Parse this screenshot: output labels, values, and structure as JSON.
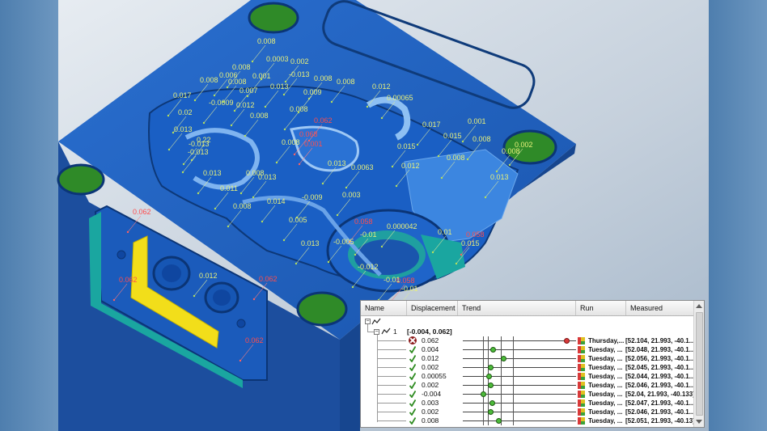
{
  "colors": {
    "background": "#6a90b4",
    "part_blue": "#1e5fb8",
    "pocket_green": "#2f8a28",
    "highlight_yellow": "#f2de1a",
    "teal_face": "#1aa6a0",
    "pass_label": "#e8f07a",
    "fail_label": "#ff4d4d"
  },
  "annotations": [
    {
      "text": "0.008",
      "fail": false
    },
    {
      "text": "0.0003",
      "fail": false
    },
    {
      "text": "0.002",
      "fail": false
    },
    {
      "text": "0.008",
      "fail": false
    },
    {
      "text": "0.001",
      "fail": false
    },
    {
      "text": "-0.013",
      "fail": false
    },
    {
      "text": "0.008",
      "fail": false
    },
    {
      "text": "0.006",
      "fail": false
    },
    {
      "text": "0.008",
      "fail": false
    },
    {
      "text": "0.008",
      "fail": false
    },
    {
      "text": "0.013",
      "fail": false
    },
    {
      "text": "0.008",
      "fail": false
    },
    {
      "text": "0.012",
      "fail": false
    },
    {
      "text": "0.007",
      "fail": false
    },
    {
      "text": "0.009",
      "fail": false
    },
    {
      "text": "0.017",
      "fail": false
    },
    {
      "text": "-0.0009",
      "fail": false
    },
    {
      "text": "0.012",
      "fail": false
    },
    {
      "text": "0.00065",
      "fail": false
    },
    {
      "text": "0.02",
      "fail": false
    },
    {
      "text": "0.008",
      "fail": false
    },
    {
      "text": "0.008",
      "fail": false
    },
    {
      "text": "0.062",
      "fail": true
    },
    {
      "text": "0.017",
      "fail": false
    },
    {
      "text": "0.001",
      "fail": false
    },
    {
      "text": "0.068",
      "fail": true
    },
    {
      "text": "0.015",
      "fail": false
    },
    {
      "text": "0.013",
      "fail": false
    },
    {
      "text": "0.22",
      "fail": false
    },
    {
      "text": "-0.013",
      "fail": false
    },
    {
      "text": "0.008",
      "fail": false
    },
    {
      "text": "0.001",
      "fail": true
    },
    {
      "text": "0.015",
      "fail": false
    },
    {
      "text": "0.008",
      "fail": false
    },
    {
      "text": "0.002",
      "fail": false
    },
    {
      "text": "-0.013",
      "fail": false
    },
    {
      "text": "0.008",
      "fail": false
    },
    {
      "text": "0.012",
      "fail": false
    },
    {
      "text": "0.013",
      "fail": false
    },
    {
      "text": "0.008",
      "fail": false
    },
    {
      "text": "0.013",
      "fail": false
    },
    {
      "text": "0.0063",
      "fail": false
    },
    {
      "text": "0.011",
      "fail": false
    },
    {
      "text": "0.013",
      "fail": false
    },
    {
      "text": "0.008",
      "fail": false
    },
    {
      "text": "-0.009",
      "fail": false
    },
    {
      "text": "0.014",
      "fail": false
    },
    {
      "text": "0.003",
      "fail": false
    },
    {
      "text": "0.062",
      "fail": true
    },
    {
      "text": "0.008",
      "fail": false
    },
    {
      "text": "0.005",
      "fail": false
    },
    {
      "text": "0.058",
      "fail": true
    },
    {
      "text": "0.000042",
      "fail": false
    },
    {
      "text": "-0.01",
      "fail": false
    },
    {
      "text": "0.01",
      "fail": false
    },
    {
      "text": "0.058",
      "fail": true
    },
    {
      "text": "0.013",
      "fail": false
    },
    {
      "text": "-0.005",
      "fail": false
    },
    {
      "text": "0.015",
      "fail": false
    },
    {
      "text": "0.012",
      "fail": false
    },
    {
      "text": "0.062",
      "fail": true
    },
    {
      "text": "0.062",
      "fail": true
    },
    {
      "text": "-0.012",
      "fail": false
    },
    {
      "text": "0.058",
      "fail": true
    },
    {
      "text": "-0.01",
      "fail": false
    },
    {
      "text": "-0.01",
      "fail": false
    },
    {
      "text": "0.062",
      "fail": true
    },
    {
      "text": "0.013",
      "fail": false
    }
  ],
  "panel": {
    "columns": {
      "name": "Name",
      "displacement": "Displacement",
      "trend": "Trend",
      "run": "Run",
      "measured": "Measured"
    },
    "group_label": "1",
    "group_range": "[-0.004, 0.062]",
    "rows": [
      {
        "status": "fail",
        "displacement": "0.062",
        "trend": 0.062,
        "run": "Thursday,...",
        "measured": "[52.104, 21.993, -40.1..."
      },
      {
        "status": "pass",
        "displacement": "0.004",
        "trend": 0.004,
        "run": "Tuesday, ...",
        "measured": "[52.048, 21.993, -40.1..."
      },
      {
        "status": "pass",
        "displacement": "0.012",
        "trend": 0.012,
        "run": "Tuesday, ...",
        "measured": "[52.056, 21.993, -40.1..."
      },
      {
        "status": "pass",
        "displacement": "0.002",
        "trend": 0.002,
        "run": "Tuesday, ...",
        "measured": "[52.045, 21.993, -40.1..."
      },
      {
        "status": "pass",
        "displacement": "0.00055",
        "trend": 0.00055,
        "run": "Tuesday, ...",
        "measured": "[52.044, 21.993, -40.1..."
      },
      {
        "status": "pass",
        "displacement": "0.002",
        "trend": 0.002,
        "run": "Tuesday, ...",
        "measured": "[52.046, 21.993, -40.1..."
      },
      {
        "status": "pass",
        "displacement": "-0.004",
        "trend": -0.004,
        "run": "Tuesday, ...",
        "measured": "[52.04, 21.993, -40.133]"
      },
      {
        "status": "pass",
        "displacement": "0.003",
        "trend": 0.003,
        "run": "Tuesday, ...",
        "measured": "[52.047, 21.993, -40.1..."
      },
      {
        "status": "pass",
        "displacement": "0.002",
        "trend": 0.002,
        "run": "Tuesday, ...",
        "measured": "[52.046, 21.993, -40.1..."
      },
      {
        "status": "pass",
        "displacement": "0.008",
        "trend": 0.008,
        "run": "Tuesday, ...",
        "measured": "[52.051, 21.993, -40.13]"
      }
    ],
    "trend_range": [
      -0.02,
      0.07
    ]
  }
}
